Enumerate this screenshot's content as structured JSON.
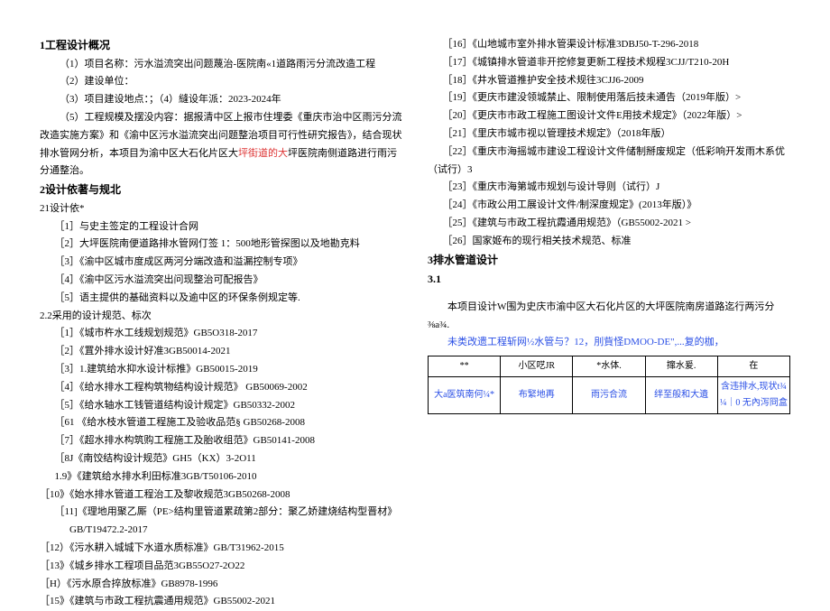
{
  "left": {
    "h1": "1工程设计概况",
    "l1": "（1）项目名称：污水溢流突出问题蔑治-医院南«1道路雨污分流改造工程",
    "l2": "（2）建设单位：",
    "l3": "（3）项目建设地点：；（4）縫设年派：2023-2024年",
    "l4_a": "（5）工程规模及摆没内容：据报清中区上报市住埋委《重庆市治中区雨污分流改造实施方案》和《渝中区污水溢流突出问题整治项目可行性研究报告》，结合现状排水管网分析，本项目为渝中区大石化片区大",
    "l4_r": "坪街道的大",
    "l4_b": "坪医院南侧道路进行雨污分通整治。",
    "h2": "2设计依著与规北",
    "h2a": "21设计依*",
    "d1": "［1］与史主签定的工程设计合网",
    "d2": "［2］大坪医院南便道路排水管网仃签 1：500地形管探图以及地勘克料",
    "d3": "［3］《渝中区城市度成区两河分端改造和溢漏控制专项》",
    "d4": "［4］《渝中区污水溢流突出问现整治可配报告》",
    "d5": "［5］语主提供的基础资料以及逾中区的环保条例规定等.",
    "h2b": "2.2采用的设计规范、标次",
    "s1": "［1］《城市杵水工线规划规范》GB5O318-2017",
    "s2": "［2］《罝外排水设计好准3GB50014-2021",
    "s3": "［3］1.建筑给水抑水设计标推》GB50015-2019",
    "s4": "［4］《给水排水工程构筑物结构设计规范》        GB50069-2002",
    "s5": "［5］《给水轴水工钱管道结构设计规定》GB50332-2002",
    "s6": "［61 《给水枝水管道工程施工及验收品范§     GB50268-2008",
    "s7": "［7］《超水排水构筑购工程施工及胎收组范》GB50141-2008",
    "s8": "［8J《南饺结构设计规范》GH5（KX）3-2O11",
    "s9": "1.9》《建筑给水排水利田标准3GB/T50106-2010",
    "s10": "［10》《始水排水管道工程治工及黎收规范3GB50268-2008",
    "s11": "［11]《理地用聚乙厮（PE>结构里管道累疏第2部分：聚乙娇建烧结构型晋材》",
    "s11b": "GB/T19472.2-2017",
    "s12": "［12）《污水耕入城城下水道水质标准》GB/T31962-2015",
    "s13": "［13》《城乡排水工程项目品范3GB55O27-2O22",
    "s14": "［H）《污水原合捽放标准》GB8978-1996",
    "s15": "［15》《建筑与市政工程抗震通用规范》GB55002-2021"
  },
  "right": {
    "r16": "［16］《山地城市室外排水管渠设计标准3DBJ50-T-296-2018",
    "r17": "［17］《城镇排水管道非开挖修复更新工程技术规程3CJJ/T210-20H",
    "r18": "［18］《井水管道推护安全技术规往3CJJ6-2009",
    "r19": "［19］《更庆市建没领城禁止、限制使用落后技未通告（2019年版）>",
    "r20": "［20］《更庆市市政工程施工图设计文件E用技术规定》（2022年版）>",
    "r21": "［21］《里庆市城市视以管理技术规定》（2018年版）",
    "r22": "［22］《重庆市海摇城市建设工程设计文件储制掰废规定（低彩响开发雨木系优（试行）3",
    "r23": "［23］《重庆市海第城市规划与设计导则（试行）J",
    "r24": "［24］《市政公用工展设计文件/制深度规定》(2013年版）》",
    "r25": "［25］《建筑与市政工程抗霞通用规范》（GB55002-2021 >",
    "r26": "［26］国家姬布的现行相关技术规范、标准",
    "h3": "3排水管道设计",
    "h3a": "3.1",
    "p1": "本项目设计W围为史庆市渝中区大石化片区的大坪医院南房道路迄行两污分⅜a¾.",
    "p2": "未类改遗工程斩网½水管与？12，刖貲怪DMOO-DE\",...复的枷，",
    "th1": "**",
    "th2": "小区呓JR",
    "th3": "*水体.",
    "th4": "撺水爰.",
    "th5": "在",
    "td1": "大a医筑南何¼*",
    "td2": "布緊地再",
    "td3": "雨污合流",
    "td4": "绊至般和大遺",
    "td5": "含违排水,现状t¾¼｜0   无內泻冏盒"
  }
}
